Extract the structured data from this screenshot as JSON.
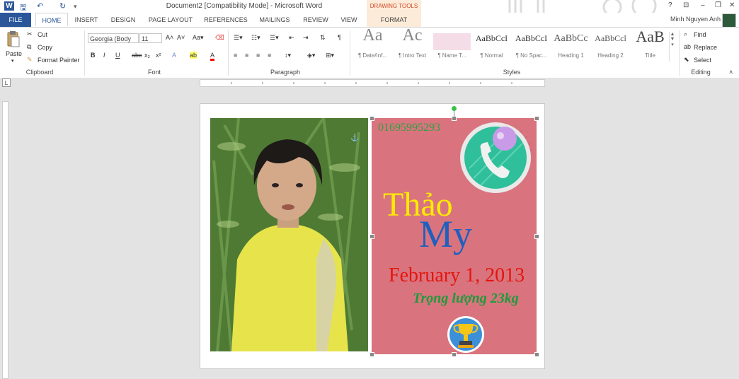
{
  "window": {
    "title": "Document2 [Compatibility Mode] - Microsoft Word",
    "drawing_tools_label": "DRAWING TOOLS",
    "app_icon_letter": "W",
    "controls": [
      "?",
      "⊡",
      "–",
      "❐",
      "✕"
    ]
  },
  "qat": {
    "save": "🖫",
    "undo": "↶",
    "redo": "↻",
    "customize": "▾"
  },
  "tabs": [
    {
      "label": "FILE"
    },
    {
      "label": "HOME"
    },
    {
      "label": "INSERT"
    },
    {
      "label": "DESIGN"
    },
    {
      "label": "PAGE LAYOUT"
    },
    {
      "label": "REFERENCES"
    },
    {
      "label": "MAILINGS"
    },
    {
      "label": "REVIEW"
    },
    {
      "label": "VIEW"
    },
    {
      "label": "FORMAT"
    }
  ],
  "user": {
    "name": "Minh Nguyen Anh"
  },
  "clipboard": {
    "paste": "Paste",
    "cut": "Cut",
    "copy": "Copy",
    "format_painter": "Format Painter",
    "group": "Clipboard"
  },
  "font": {
    "family": "Georgia (Body",
    "size": "11",
    "group": "Font",
    "buttons": [
      "B",
      "I",
      "U",
      "abc",
      "x₂",
      "x²",
      "A",
      "ab",
      "A"
    ]
  },
  "paragraph": {
    "group": "Paragraph"
  },
  "styles": {
    "group": "Styles",
    "items": [
      {
        "sample": "Aa",
        "name": "¶ Date/Inf..."
      },
      {
        "sample": "Ac",
        "name": "¶ Intro Text"
      },
      {
        "sample": "",
        "name": "¶ Name T..."
      },
      {
        "sample": "AaBbCcI",
        "name": "¶ Normal"
      },
      {
        "sample": "AaBbCcI",
        "name": "¶ No Spac..."
      },
      {
        "sample": "AaBbCc",
        "name": "Heading 1"
      },
      {
        "sample": "AaBbCcl",
        "name": "Heading 2"
      },
      {
        "sample": "AaB",
        "name": "Title"
      }
    ]
  },
  "editing": {
    "find": "Find",
    "replace": "Replace",
    "select": "Select",
    "group": "Editing"
  },
  "ruler": {
    "tab_selector": "L"
  },
  "document": {
    "phone": "01695995293",
    "name_first": "Thảo",
    "name_last": "My",
    "date": "February 1, 2013",
    "weight": "Trọng lượng 23kg"
  },
  "colors": {
    "accent": "#2b579a",
    "card_background": "#d9747e",
    "phone_text": "#2ea043",
    "name_first": "#ffeb00",
    "name_last": "#1f5fbf",
    "date_text": "#e4150e",
    "weight_text": "#1e9a3c"
  },
  "icons": {
    "phone": "phone-icon",
    "trophy": "trophy-icon"
  }
}
